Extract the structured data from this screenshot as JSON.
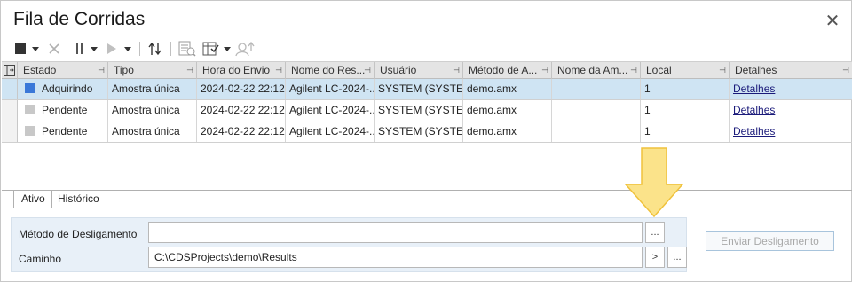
{
  "window": {
    "title": "Fila de Corridas",
    "close_label": "✕"
  },
  "toolbar": {
    "icons": [
      "stop-icon",
      "dropdown-icon",
      "cancel-icon",
      "pause-icon",
      "dropdown-icon",
      "play-icon",
      "dropdown-icon",
      "sort-arrows-icon",
      "queue-view-icon",
      "column-chooser-icon",
      "user-icon"
    ]
  },
  "grid": {
    "columns": [
      "Estado",
      "Tipo",
      "Hora do Envio",
      "Nome do Res...",
      "Usuário",
      "Método de A...",
      "Nome da Am...",
      "Local",
      "Detalhes"
    ],
    "rows": [
      {
        "estado": "Adquirindo",
        "status_color": "#3a78d8",
        "tipo": "Amostra única",
        "hora": "2024-02-22 22:12...",
        "nome_res": "Agilent LC-2024-...",
        "usuario": "SYSTEM (SYSTEM)",
        "metodo": "demo.amx",
        "nome_am": "",
        "local": "1",
        "detalhes": "Detalhes"
      },
      {
        "estado": "Pendente",
        "status_color": "#c8c8c8",
        "tipo": "Amostra única",
        "hora": "2024-02-22 22:12...",
        "nome_res": "Agilent LC-2024-...",
        "usuario": "SYSTEM (SYSTEM)",
        "metodo": "demo.amx",
        "nome_am": "",
        "local": "1",
        "detalhes": "Detalhes"
      },
      {
        "estado": "Pendente",
        "status_color": "#c8c8c8",
        "tipo": "Amostra única",
        "hora": "2024-02-22 22:12...",
        "nome_res": "Agilent LC-2024-...",
        "usuario": "SYSTEM (SYSTEM)",
        "metodo": "demo.amx",
        "nome_am": "",
        "local": "1",
        "detalhes": "Detalhes"
      }
    ],
    "selected_row": 0
  },
  "tabs": {
    "ativo": "Ativo",
    "historico": "Histórico"
  },
  "shutdown": {
    "method_label": "Método de Desligamento",
    "method_value": "",
    "path_label": "Caminho",
    "path_value": "C:\\CDSProjects\\demo\\Results",
    "browse_label": "...",
    "next_label": ">",
    "send_label": "Enviar Desligamento"
  },
  "colors": {
    "selection": "#cfe4f3",
    "panel": "#e8f0f8",
    "arrow": "#fbe38a",
    "arrow_border": "#f0c23c"
  }
}
